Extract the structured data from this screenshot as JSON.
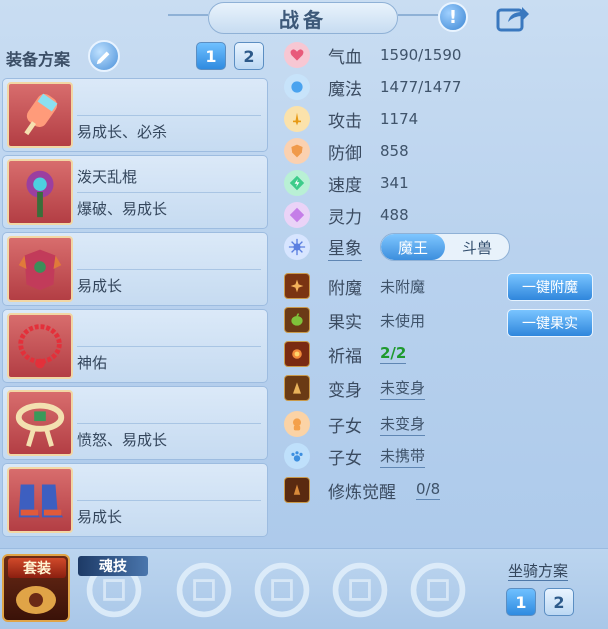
{
  "title": "战备",
  "equip_scheme": {
    "label": "装备方案",
    "buttons": [
      "1",
      "2"
    ],
    "active": "1"
  },
  "equipment": [
    {
      "name": "",
      "attr": "易成长、必杀"
    },
    {
      "name": "泼天乱棍",
      "attr": "爆破、易成长"
    },
    {
      "name": "",
      "attr": "易成长"
    },
    {
      "name": "",
      "attr": "神佑"
    },
    {
      "name": "",
      "attr": "愤怒、易成长"
    },
    {
      "name": "",
      "attr": "易成长"
    }
  ],
  "stats": [
    {
      "label": "气血",
      "value": "1590/1590",
      "icon": "heart-icon",
      "color": "#e85a7a"
    },
    {
      "label": "魔法",
      "value": "1477/1477",
      "icon": "mana-icon",
      "color": "#4aa3ef"
    },
    {
      "label": "攻击",
      "value": "1174",
      "icon": "sword-icon",
      "color": "#f2b02e"
    },
    {
      "label": "防御",
      "value": "858",
      "icon": "shield-icon",
      "color": "#f09a4a"
    },
    {
      "label": "速度",
      "value": "341",
      "icon": "speed-icon",
      "color": "#3dcc8a"
    },
    {
      "label": "灵力",
      "value": "488",
      "icon": "spirit-icon",
      "color": "#c57ee8"
    }
  ],
  "star_sign": {
    "label": "星象",
    "options": [
      "魔王",
      "斗兽"
    ],
    "selected": "魔王"
  },
  "extras": [
    {
      "label": "附魔",
      "value": "未附魔",
      "icon": "enchant-icon"
    },
    {
      "label": "果实",
      "value": "未使用",
      "icon": "fruit-icon"
    },
    {
      "label": "祈福",
      "value": "2/2",
      "icon": "blessing-icon"
    },
    {
      "label": "变身",
      "value": "未变身",
      "icon": "transform-icon"
    },
    {
      "label": "子女",
      "value": "未变身",
      "icon": "child-icon"
    },
    {
      "label": "子女",
      "value": "未携带",
      "icon": "pet-paw-icon"
    },
    {
      "label": "修炼觉醒",
      "value": "0/8",
      "icon": "awaken-icon"
    }
  ],
  "actions": {
    "enchant": "一键附魔",
    "fruit": "一键果实"
  },
  "bottom": {
    "suit": "套装",
    "soul": "魂技",
    "mount_label": "坐骑方案",
    "mount_buttons": [
      "1",
      "2"
    ]
  },
  "colors": {
    "accent": "#3c8edd",
    "panel": "#c6dbf1",
    "blessing_green": "#1f9a2e"
  }
}
